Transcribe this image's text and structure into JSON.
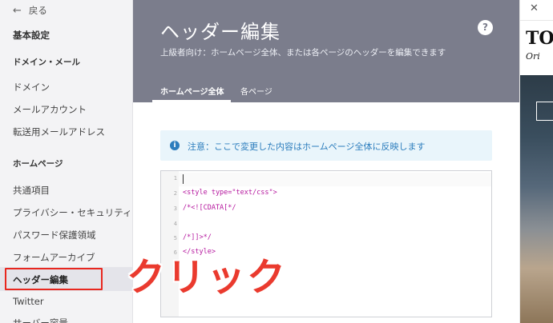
{
  "sidebar": {
    "back_label": "戻る",
    "basic_settings": "基本設定",
    "section_domain": "ドメイン・メール",
    "domain": "ドメイン",
    "mail_account": "メールアカウント",
    "forwarding": "転送用メールアドレス",
    "section_homepage": "ホームページ",
    "common": "共通項目",
    "privacy": "プライバシー・セキュリティ",
    "password": "パスワード保護領域",
    "form_archive": "フォームアーカイブ",
    "header_edit": "ヘッダー編集",
    "twitter": "Twitter",
    "server_capacity": "サーバー容量"
  },
  "main": {
    "title": "ヘッダー編集",
    "subtitle": "上級者向け：ホームページ全体、または各ページのヘッダーを編集できます",
    "help_icon": "?",
    "tabs": [
      {
        "label": "ホームページ全体",
        "active": true
      },
      {
        "label": "各ページ",
        "active": false
      }
    ],
    "notice": "注意：ここで変更した内容はホームページ全体に反映します",
    "notice_icon": "i",
    "editor": {
      "line_numbers": [
        "1",
        "2",
        "3",
        "4",
        "5",
        "6"
      ],
      "lines": [
        "",
        "<style type=\"text/css\">",
        "/*<![CDATA[*/",
        "",
        "/*]]>*/",
        "</style>"
      ]
    }
  },
  "preview": {
    "close_icon": "✕",
    "logo": "TO",
    "logo_sub": "Ori"
  },
  "annotation": {
    "click_text": "クリック",
    "color": "#ea3a2e"
  },
  "colors": {
    "header_bg": "#7b7d8c",
    "notice_bg": "#e9f5fb",
    "notice_text": "#2c7dbd",
    "highlight_box": "#e8271f"
  }
}
